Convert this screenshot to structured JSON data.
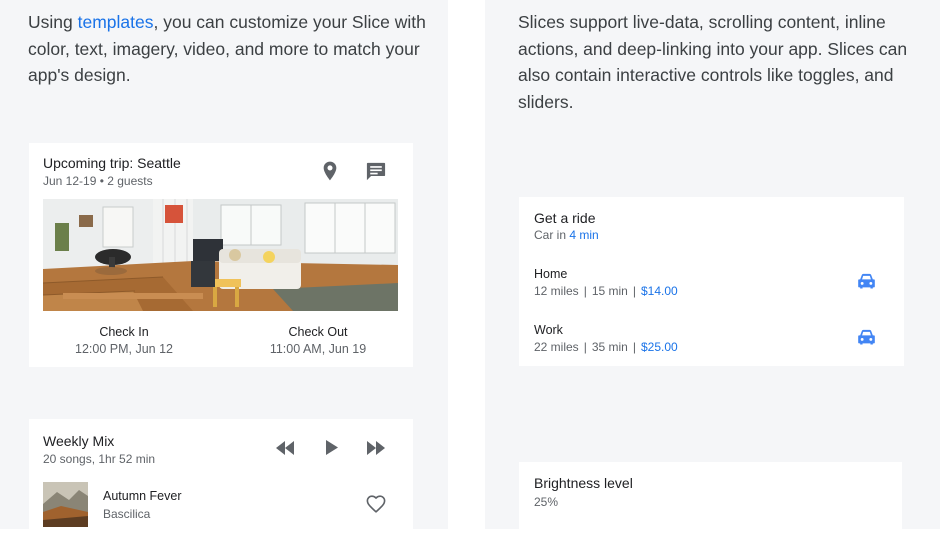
{
  "left_intro": {
    "prefix": "Using ",
    "link": "templates",
    "suffix": ", you can customize your Slice with color, text, imagery, video, and more to match your app's design."
  },
  "right_intro": {
    "text": "Slices support live-data, scrolling content, inline actions, and deep-linking into your app. Slices can also contain interactive controls like toggles, and sliders."
  },
  "trip_card": {
    "title": "Upcoming trip: Seattle",
    "subtitle": "Jun 12-19 • 2 guests",
    "check_in_label": "Check In",
    "check_in_value": "12:00 PM, Jun 12",
    "check_out_label": "Check Out",
    "check_out_value": "11:00 AM, Jun 19"
  },
  "mix_card": {
    "title": "Weekly Mix",
    "subtitle": "20 songs, 1hr 52 min",
    "song_title": "Autumn Fever",
    "song_artist": "Bascilica"
  },
  "ride_card": {
    "title": "Get a ride",
    "subtitle_prefix": "Car in ",
    "subtitle_eta": "4 min",
    "rides": [
      {
        "name": "Home",
        "distance": "12 miles",
        "time": "15 min",
        "price": "$14.00"
      },
      {
        "name": "Work",
        "distance": "22 miles",
        "time": "35 min",
        "price": "$25.00"
      }
    ],
    "separator": "|"
  },
  "brightness_card": {
    "title": "Brightness level",
    "value": "25%"
  },
  "colors": {
    "accent": "#1a73e8",
    "icon_gray": "#5f6368",
    "car_blue": "#4285f4",
    "background": "#f5f6f8"
  },
  "icons": {
    "location": "location-pin-icon",
    "message": "message-icon",
    "rewind": "rewind-icon",
    "play": "play-icon",
    "fast_forward": "fast-forward-icon",
    "heart": "heart-icon",
    "car": "car-icon"
  }
}
